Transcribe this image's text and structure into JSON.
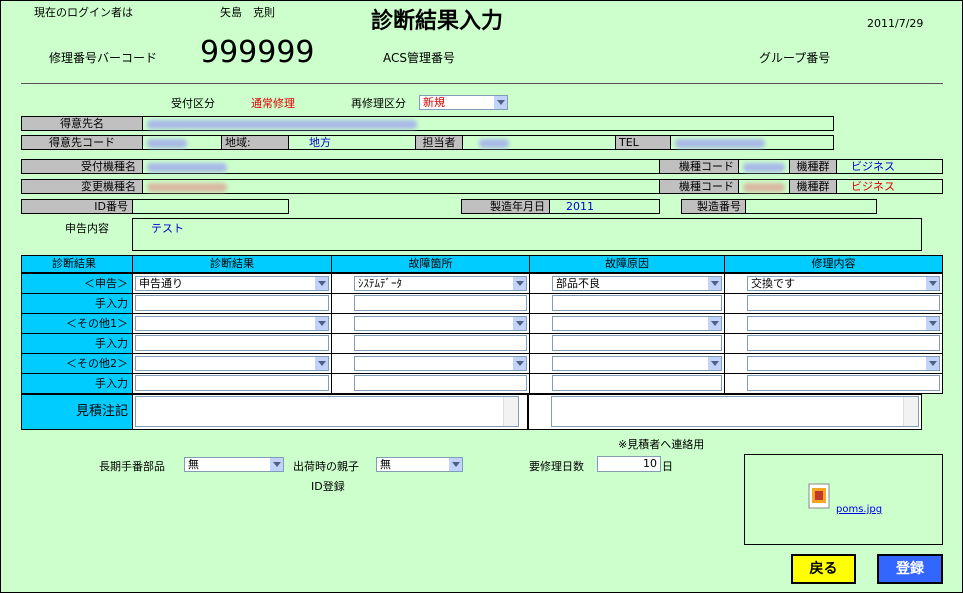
{
  "header": {
    "login_label": "現在のログイン者は",
    "login_user": "矢島　克則",
    "title": "診断結果入力",
    "date": "2011/7/29",
    "repair_barcode_label": "修理番号バーコード",
    "repair_number": "999999",
    "acs_label": "ACS管理番号",
    "group_label": "グループ番号"
  },
  "reception": {
    "type_label": "受付区分",
    "type_value": "通常修理",
    "rerepair_label": "再修理区分",
    "rerepair_value": "新規"
  },
  "customer": {
    "name_label": "得意先名",
    "code_label": "得意先コード",
    "region_label": "地域:",
    "region_value": "地方",
    "person_label": "担当者",
    "tel_label": "TEL"
  },
  "model": {
    "received_label": "受付機種名",
    "changed_label": "変更機種名",
    "code_label": "機種コード",
    "group_label": "機種群",
    "group_value_1": "ビジネス",
    "group_value_2": "ビジネス",
    "id_label": "ID番号",
    "mfg_date_label": "製造年月日",
    "mfg_date_value": "2011",
    "serial_label": "製造番号"
  },
  "report": {
    "label": "申告内容",
    "value": "テスト"
  },
  "diagnosis": {
    "headers": [
      "診断結果",
      "診断結果",
      "故障箇所",
      "故障原因",
      "修理内容"
    ],
    "rows": [
      {
        "label": "＜申告＞",
        "c1": "申告通り",
        "c2": "ｼｽﾃﾑﾃﾞｰﾀ",
        "c3": "部品不良",
        "c4": "交換です"
      },
      {
        "label": "手入力"
      },
      {
        "label": "＜その他1＞",
        "c1": "",
        "c2": "",
        "c3": "",
        "c4": ""
      },
      {
        "label": "手入力"
      },
      {
        "label": "＜その他2＞",
        "c1": "",
        "c2": "",
        "c3": "",
        "c4": ""
      },
      {
        "label": "手入力"
      }
    ],
    "estimate_label": "見積注記"
  },
  "notes": {
    "estimate_contact": "※見積者へ連絡用",
    "long_parts_label": "長期手番部品",
    "long_parts_value": "無",
    "ship_parent_label": "出荷時の親子",
    "ship_parent_value": "無",
    "id_register_label": "ID登録",
    "repair_days_label": "要修理日数",
    "repair_days_value": "10",
    "repair_days_unit": "日",
    "attachment_name": "poms.jpg"
  },
  "buttons": {
    "back": "戻る",
    "register": "登録"
  },
  "colors": {
    "background": "#ccffcc",
    "header_cyan": "#00ccff",
    "label_gray": "#c0c0c0",
    "red_text": "#e00000",
    "blue_text": "#0000cc",
    "back_button": "#ffff00",
    "register_button": "#3366ff"
  }
}
